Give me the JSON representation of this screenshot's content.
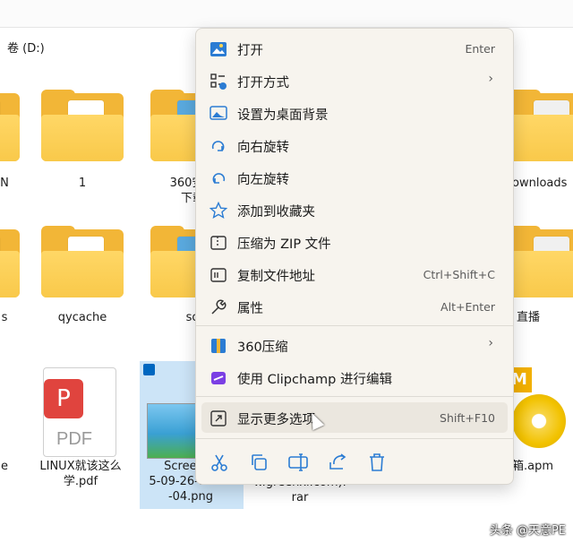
{
  "address": {
    "text": "卷 (D:)"
  },
  "files": [
    {
      "label": "N"
    },
    {
      "label": "1"
    },
    {
      "label": "360安全\n下载"
    },
    {
      "label": "Downloads"
    },
    {
      "label": "s"
    },
    {
      "label": "qycache"
    },
    {
      "label": "so"
    },
    {
      "label": "直播"
    },
    {
      "label": "e"
    },
    {
      "label": "LINUX就该这么\n学.pdf"
    },
    {
      "label": "Screensh\n5-09-26-12-30\n-04.png"
    },
    {
      "label": "w.greenxi.com).\nrar"
    },
    {
      "label": "箱.apm"
    }
  ],
  "context_menu": {
    "items": [
      {
        "icon": "photo-open-icon",
        "label": "打开",
        "shortcut": "Enter"
      },
      {
        "icon": "open-with-icon",
        "label": "打开方式",
        "submenu": true
      },
      {
        "icon": "desktop-background-icon",
        "label": "设置为桌面背景"
      },
      {
        "icon": "rotate-right-icon",
        "label": "向右旋转"
      },
      {
        "icon": "rotate-left-icon",
        "label": "向左旋转"
      },
      {
        "icon": "star-icon",
        "label": "添加到收藏夹"
      },
      {
        "icon": "zip-icon",
        "label": "压缩为 ZIP 文件"
      },
      {
        "icon": "copy-path-icon",
        "label": "复制文件地址",
        "shortcut": "Ctrl+Shift+C"
      },
      {
        "icon": "wrench-icon",
        "label": "属性",
        "shortcut": "Alt+Enter"
      },
      {
        "icon": "compress360-icon",
        "label": "360压缩",
        "submenu": true
      },
      {
        "icon": "clipchamp-icon",
        "label": "使用 Clipchamp 进行编辑"
      },
      {
        "icon": "more-options-icon",
        "label": "显示更多选项",
        "shortcut": "Shift+F10"
      }
    ],
    "quick_actions": [
      "cut-icon",
      "copy-icon",
      "rename-icon",
      "share-icon",
      "delete-icon"
    ]
  },
  "watermark": "头条 @天意PE"
}
